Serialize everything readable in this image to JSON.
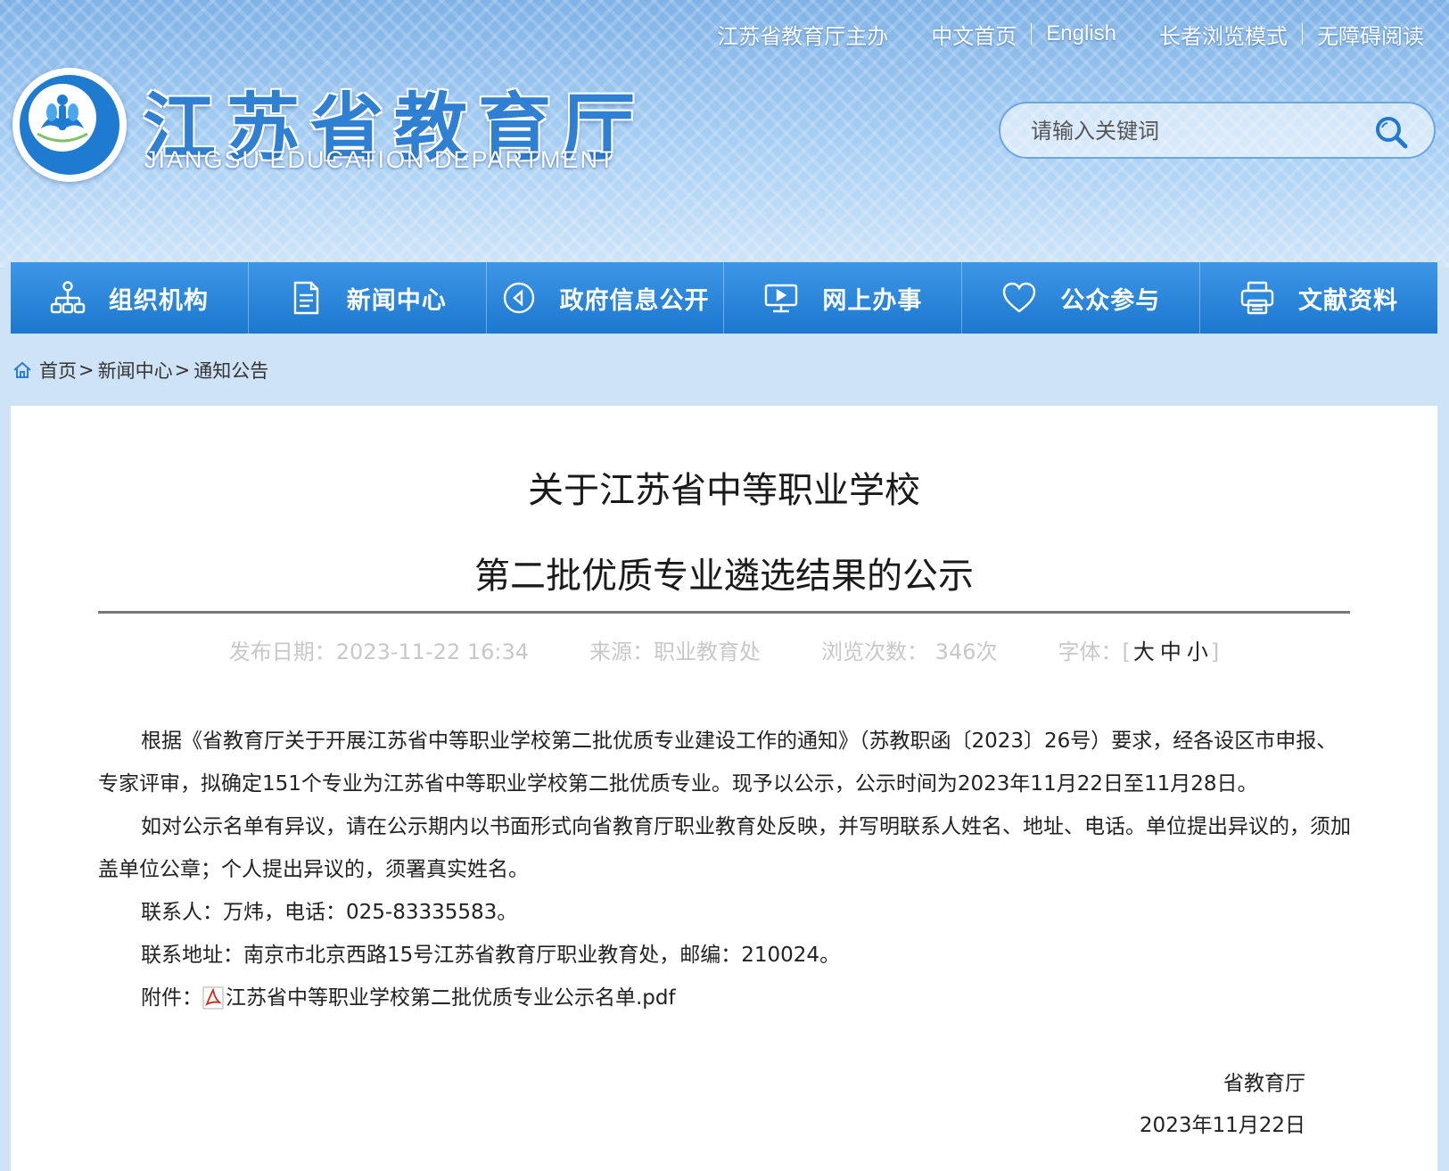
{
  "header": {
    "top_links": {
      "sponsor": "江苏省教育厅主办",
      "home_cn": "中文首页",
      "english": "English",
      "elder_mode": "长者浏览模式",
      "accessible": "无障碍阅读"
    },
    "logo_cn": "江苏省教育厅",
    "logo_en": "JIANGSU EDUCATION DEPARTMENT",
    "search": {
      "placeholder": "请输入关键词",
      "icon": "search-icon"
    }
  },
  "nav": {
    "items": [
      {
        "label": "组织机构",
        "icon": "org-chart-icon"
      },
      {
        "label": "新闻中心",
        "icon": "document-icon"
      },
      {
        "label": "政府信息公开",
        "icon": "play-circle-icon"
      },
      {
        "label": "网上办事",
        "icon": "monitor-icon"
      },
      {
        "label": "公众参与",
        "icon": "heart-icon"
      },
      {
        "label": "文献资料",
        "icon": "printer-icon"
      }
    ]
  },
  "breadcrumb": {
    "icon": "home-icon",
    "home": "首页",
    "level1": "新闻中心",
    "level2": "通知公告",
    "arrow": ">"
  },
  "article": {
    "title_line1": "关于江苏省中等职业学校",
    "title_line2": "第二批优质专业遴选结果的公示",
    "meta": {
      "date": "发布日期：2023-11-22 16:34",
      "source": "来源：职业教育处",
      "views": "浏览次数： 346次",
      "font_label": "字体：",
      "bracket_open": "[",
      "bracket_close": "]",
      "font_large": "大",
      "font_medium": "中",
      "font_small": "小"
    },
    "paragraphs": [
      "根据《省教育厅关于开展江苏省中等职业学校第二批优质专业建设工作的通知》（苏教职函〔2023〕26号）要求，经各设区市申报、专家评审，拟确定151个专业为江苏省中等职业学校第二批优质专业。现予以公示，公示时间为2023年11月22日至11月28日。",
      "如对公示名单有异议，请在公示期内以书面形式向省教育厅职业教育处反映，并写明联系人姓名、地址、电话。单位提出异议的，须加盖单位公章；个人提出异议的，须署真实姓名。",
      "联系人：万炜，电话：025-83335583。",
      "联系地址：南京市北京西路15号江苏省教育厅职业教育处，邮编：210024。"
    ],
    "attachment_label": "附件：",
    "attachment_icon": "pdf-icon",
    "attachment_name": "江苏省中等职业学校第二批优质专业公示名单.pdf",
    "signature_org": "省教育厅",
    "signature_date": "2023年11月22日"
  }
}
